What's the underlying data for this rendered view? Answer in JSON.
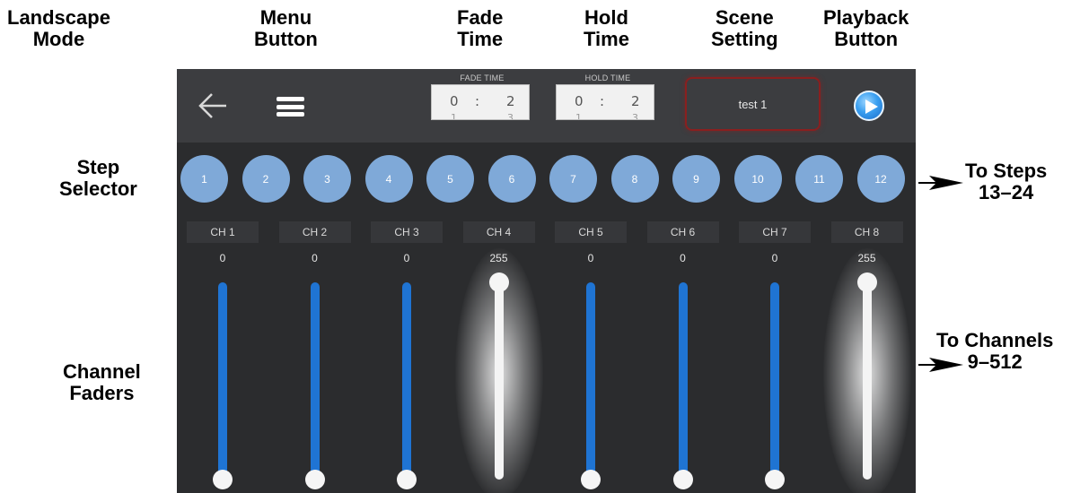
{
  "callouts": {
    "landscape": [
      "Landscape",
      "Mode"
    ],
    "menu": [
      "Menu",
      "Button"
    ],
    "fade": [
      "Fade",
      "Time"
    ],
    "hold": [
      "Hold",
      "Time"
    ],
    "scene": [
      "Scene",
      "Setting"
    ],
    "playback": [
      "Playback",
      "Button"
    ],
    "step_selector": [
      "Step",
      "Selector"
    ],
    "channel_faders": [
      "Channel",
      "Faders"
    ],
    "to_steps": [
      "To Steps",
      "13–24"
    ],
    "to_channels": [
      "To Channels",
      "9–512"
    ]
  },
  "topbar": {
    "back_icon": "arrow-left-icon",
    "menu_icon": "hamburger-menu-icon",
    "fade_time": {
      "label": "FADE TIME",
      "minutes": "0",
      "sep": ":",
      "seconds": "2",
      "next_minutes": "1",
      "next_seconds": "3"
    },
    "hold_time": {
      "label": "HOLD TIME",
      "minutes": "0",
      "sep": ":",
      "seconds": "2",
      "next_minutes": "1",
      "next_seconds": "3"
    },
    "scene_name": "test 1",
    "play_icon": "play-icon"
  },
  "steps": [
    "1",
    "2",
    "3",
    "4",
    "5",
    "6",
    "7",
    "8",
    "9",
    "10",
    "11",
    "12"
  ],
  "channels": [
    {
      "label": "CH 1",
      "value": "0",
      "level": 0
    },
    {
      "label": "CH 2",
      "value": "0",
      "level": 0
    },
    {
      "label": "CH 3",
      "value": "0",
      "level": 0
    },
    {
      "label": "CH 4",
      "value": "255",
      "level": 1
    },
    {
      "label": "CH 5",
      "value": "0",
      "level": 0
    },
    {
      "label": "CH 6",
      "value": "0",
      "level": 0
    },
    {
      "label": "CH 7",
      "value": "0",
      "level": 0
    },
    {
      "label": "CH 8",
      "value": "255",
      "level": 1
    }
  ],
  "colors": {
    "track_off": "#1f74d3",
    "track_on": "#f4f4f4",
    "step": "#7fa9d8",
    "scene_border": "#8a1f1f"
  }
}
